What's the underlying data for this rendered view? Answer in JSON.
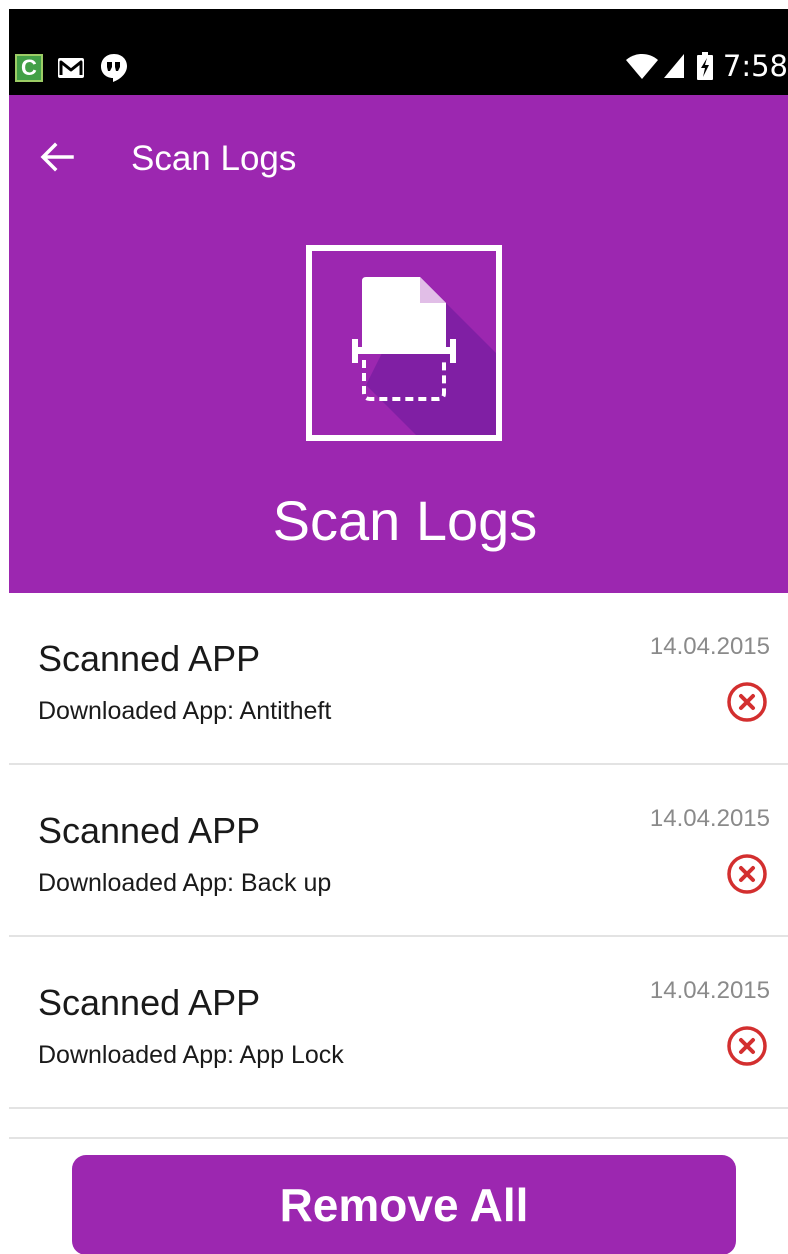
{
  "status_bar": {
    "app_icon_letter": "C",
    "time": "7:58",
    "icons": [
      "app-c-icon",
      "gmail-icon",
      "hangouts-icon",
      "wifi-icon",
      "signal-icon",
      "battery-charging-icon"
    ]
  },
  "toolbar": {
    "back_icon": "arrow-left-icon",
    "title": "Scan Logs"
  },
  "hero": {
    "icon": "document-scan-icon",
    "title": "Scan Logs"
  },
  "logs": [
    {
      "title": "Scanned APP",
      "subtitle": "Downloaded App: Antitheft",
      "date": "14.04.2015"
    },
    {
      "title": "Scanned APP",
      "subtitle": "Downloaded App: Back up",
      "date": "14.04.2015"
    },
    {
      "title": "Scanned APP",
      "subtitle": "Downloaded App: App Lock",
      "date": "14.04.2015"
    }
  ],
  "remove_all_label": "Remove All",
  "colors": {
    "primary": "#9c27b0",
    "remove_icon": "#d32f2f",
    "date_text": "#8a8a8a",
    "status_bar": "#000000"
  }
}
